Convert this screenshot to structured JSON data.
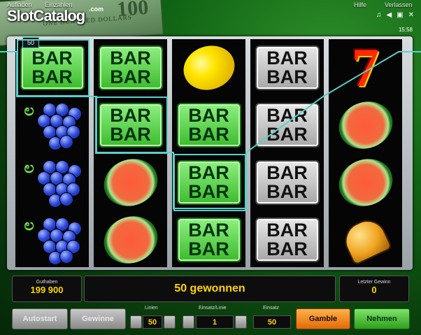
{
  "topbar": {
    "aufladen": "Aufladen",
    "einzahlen": "Einzahlen",
    "hilfe": "Hilfe",
    "verlassen": "Verlassen",
    "clock": "15:58"
  },
  "logo": {
    "text": "SlotCatalog",
    "com": ".com"
  },
  "banknote": {
    "text": "ONE HUNDRED DOLLARS",
    "number": "100"
  },
  "icons": [
    "music-icon",
    "speaker-icon",
    "fullscreen-icon",
    "close-icon"
  ],
  "line_marker": "50",
  "reels": [
    [
      "bar-green",
      "grape",
      "grape",
      "grape"
    ],
    [
      "bar-green",
      "bar-green",
      "melon",
      "melon"
    ],
    [
      "lemon",
      "bar-green",
      "bar-green",
      "bar-green"
    ],
    [
      "bar-grey",
      "bar-grey",
      "bar-grey",
      "bar-grey"
    ],
    [
      "seven",
      "melon",
      "melon",
      "bell"
    ]
  ],
  "bar_text": {
    "line1": "BAR",
    "line2": "BAR"
  },
  "bottom": {
    "guthaben_label": "Guthaben",
    "guthaben_value": "199 900",
    "message": "50 gewonnen",
    "letzter_label": "Letzter Gewinn",
    "letzter_value": "0"
  },
  "controls": {
    "autostart": "Autostart",
    "gewinne": "Gewinne",
    "linien_label": "Linien",
    "linien_value": "50",
    "einsatz_linie_label": "Einsatz/Linie",
    "einsatz_linie_value": "1",
    "einsatz_label": "Einsatz",
    "einsatz_value": "50",
    "gamble": "Gamble",
    "nehmen": "Nehmen"
  },
  "colors": {
    "accent": "#ffd400",
    "highlight": "#5ad0c8",
    "gamble": "#e26b05",
    "nehmen": "#2e9f1c"
  }
}
